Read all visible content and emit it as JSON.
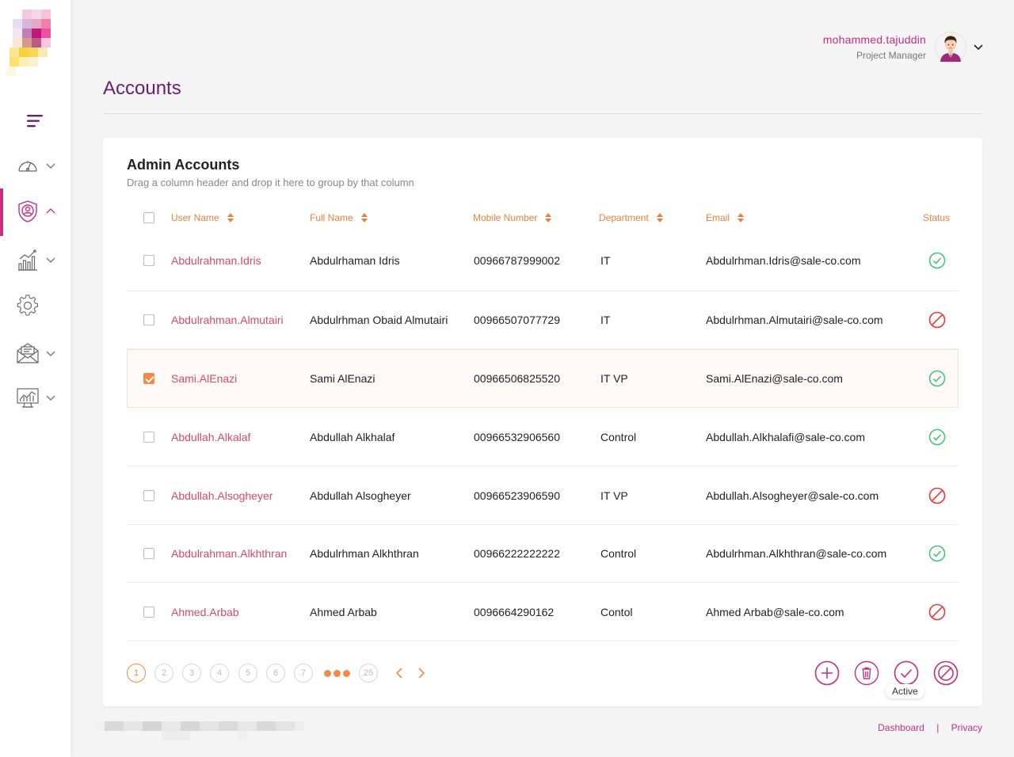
{
  "header": {
    "user_name": "mohammed.tajuddin",
    "user_role": "Project Manager"
  },
  "page": {
    "title": "Accounts"
  },
  "card": {
    "title": "Admin Accounts",
    "hint": "Drag a column header and drop it here to group by that column"
  },
  "columns": [
    {
      "label": "User Name",
      "sortable": true
    },
    {
      "label": "Full Name",
      "sortable": true
    },
    {
      "label": "Mobile Number",
      "sortable": true
    },
    {
      "label": "Department",
      "sortable": true
    },
    {
      "label": "Email",
      "sortable": true
    },
    {
      "label": "Status",
      "sortable": false
    }
  ],
  "rows": [
    {
      "username": "Abdulrahman.Idris",
      "fullname": "Abdulrhaman Idris",
      "mobile": "00966787999002",
      "department": "IT",
      "email": "Abdulrhman.Idris@sale-co.com",
      "status": "active",
      "checked": false
    },
    {
      "username": "Abdulrahman.Almutairi",
      "fullname": "Abdulrhman Obaid Almutairi",
      "mobile": "00966507077729",
      "department": "IT",
      "email": "Abdulrhman.Almutairi@sale-co.com",
      "status": "inactive",
      "checked": false
    },
    {
      "username": "Sami.AlEnazi",
      "fullname": "Sami AlEnazi",
      "mobile": "00966506825520",
      "department": "IT VP",
      "email": "Sami.AlEnazi@sale-co.com",
      "status": "active",
      "checked": true
    },
    {
      "username": "Abdullah.Alkalaf",
      "fullname": "Abdullah Alkhalaf",
      "mobile": "00966532906560",
      "department": "Control",
      "email": "Abdullah.Alkhalafi@sale-co.com",
      "status": "active",
      "checked": false
    },
    {
      "username": "Abdullah.Alsogheyer",
      "fullname": "Abdullah Alsogheyer",
      "mobile": "00966523906590",
      "department": "IT VP",
      "email": "Abdullah.Alsogheyer@sale-co.com",
      "status": "inactive",
      "checked": false
    },
    {
      "username": "Abdulrahman.Alkhthran",
      "fullname": "Abdulrhman Alkhthran",
      "mobile": "00966222222222",
      "department": "Control",
      "email": "Abdulrhman.Alkhthran@sale-co.com",
      "status": "active",
      "checked": false
    },
    {
      "username": "Ahmed.Arbab",
      "fullname": "Ahmed Arbab",
      "mobile": "0096664290162",
      "department": "Contol",
      "email": "Ahmed Arbab@sale-co.com",
      "status": "inactive",
      "checked": false
    }
  ],
  "pagination": {
    "pages": [
      "1",
      "2",
      "3",
      "4",
      "5",
      "6",
      "7"
    ],
    "last_page": "25",
    "current": "1"
  },
  "actions": {
    "tooltip": "Active"
  },
  "footer": {
    "links": [
      "Dashboard",
      "Privacy"
    ],
    "separator": "|"
  },
  "colors": {
    "brand": "#c4307c",
    "accent": "#f08a45",
    "title": "#6a1f6e",
    "active_status": "#3cc37a",
    "inactive_status": "#e53935"
  },
  "icons": {
    "nav": [
      "dashboard-gauge-icon",
      "user-shield-icon",
      "bar-chart-icon",
      "settings-gear-icon",
      "mail-envelope-icon",
      "monitor-chart-icon"
    ],
    "actions": [
      "add-icon",
      "delete-icon",
      "activate-icon",
      "deactivate-icon"
    ]
  }
}
